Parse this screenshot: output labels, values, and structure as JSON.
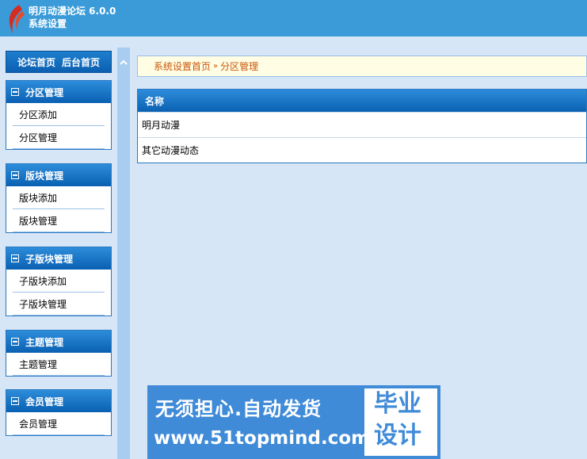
{
  "header": {
    "app_name": "明月动漫论坛 6.0.0",
    "subtitle": "系统设置"
  },
  "topnav": {
    "forum_home": "论坛首页",
    "admin_home": "后台首页"
  },
  "sidebar": {
    "groups": [
      {
        "title": "分区管理",
        "items": [
          "分区添加",
          "分区管理"
        ]
      },
      {
        "title": "版块管理",
        "items": [
          "版块添加",
          "版块管理"
        ]
      },
      {
        "title": "子版块管理",
        "items": [
          "子版块添加",
          "子版块管理"
        ]
      },
      {
        "title": "主题管理",
        "items": [
          "主题管理"
        ]
      },
      {
        "title": "会员管理",
        "items": [
          "会员管理"
        ]
      }
    ]
  },
  "breadcrumb": {
    "home": "系统设置首页",
    "separator": "»",
    "current": "分区管理"
  },
  "table": {
    "header": "名称",
    "rows": [
      "明月动漫",
      "其它动漫动态"
    ]
  },
  "banner": {
    "slogan": "无须担心.自动发货",
    "url": "www.51topmind.com",
    "tag_line1": "毕业",
    "tag_line2": "设计"
  },
  "icons": {
    "logo": "flame-logo-icon",
    "collapse": "chevron-up-icon",
    "group_toggle": "minus-box-icon"
  }
}
